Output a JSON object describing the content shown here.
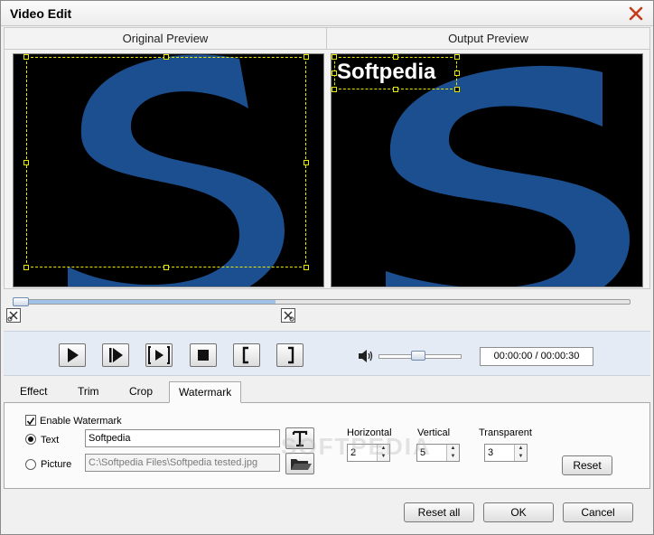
{
  "window": {
    "title": "Video Edit"
  },
  "preview": {
    "original_label": "Original Preview",
    "output_label": "Output Preview",
    "watermark_text": "Softpedia"
  },
  "player": {
    "time": "00:00:00 / 00:00:30",
    "progress": 0.0,
    "volume": 0.45
  },
  "tabs": [
    "Effect",
    "Trim",
    "Crop",
    "Watermark"
  ],
  "watermark": {
    "enable_label": "Enable Watermark",
    "text_option": "Text",
    "picture_option": "Picture",
    "text_value": "Softpedia",
    "picture_value": "C:\\Softpedia Files\\Softpedia tested.jpg",
    "horizontal_label": "Horizontal",
    "vertical_label": "Vertical",
    "transparent_label": "Transparent",
    "horizontal_value": "2",
    "vertical_value": "5",
    "transparent_value": "3",
    "reset_label": "Reset",
    "logo_text": "SOFTPEDIA"
  },
  "footer": {
    "reset_all": "Reset all",
    "ok": "OK",
    "cancel": "Cancel"
  },
  "colors": {
    "s_blue": "#1c4f8f",
    "selection_yellow": "#e8e800"
  }
}
